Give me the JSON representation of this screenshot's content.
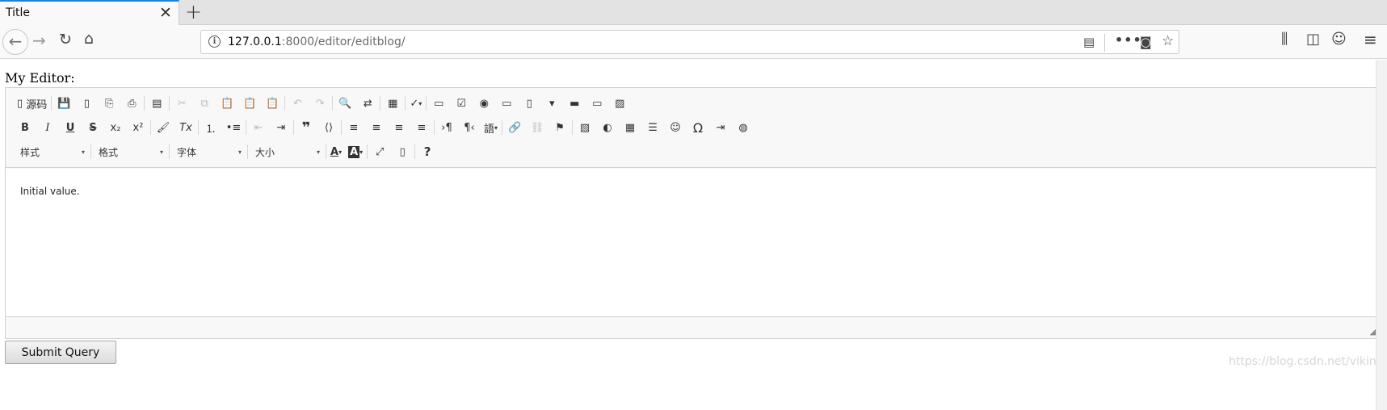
{
  "tab": {
    "title": "Title",
    "close_glyph": "✕",
    "new_tab_glyph": "+"
  },
  "nav": {
    "back_glyph": "←",
    "forward_glyph": "→",
    "reload_glyph": "↻",
    "home_glyph": "⌂",
    "url_host": "127.0.0.1",
    "url_rest": ":8000/editor/editblog/",
    "info_glyph": "i",
    "reader_glyph": "▤",
    "more_glyph": "•••",
    "pocket_glyph": "◙",
    "star_glyph": "☆",
    "library_glyph": "⫼",
    "sidebar_glyph": "◫",
    "account_glyph": "☺",
    "menu_glyph": "≡"
  },
  "page": {
    "label": "My Editor:",
    "submit_label": "Submit Query",
    "watermark": "https://blog.csdn.net/viking"
  },
  "editor": {
    "source_label": "源码",
    "combos": {
      "styles": "样式",
      "format": "格式",
      "font": "字体",
      "size": "大小"
    },
    "content": "Initial value.",
    "resize_glyph": "◢"
  },
  "toolbar_glyphs": {
    "source": "▯",
    "save": "💾",
    "newpage": "▯",
    "preview": "⎘",
    "print": "⎙",
    "templates": "▤",
    "cut": "✂",
    "copy": "⧉",
    "paste": "📋",
    "pastetext": "📋",
    "pasteword": "📋",
    "undo": "↶",
    "redo": "↷",
    "find": "🔍",
    "replace": "⇄",
    "selectall": "▦",
    "spellcheck": "✓",
    "form": "▭",
    "checkbox": "☑",
    "radio": "◉",
    "textfield": "▭",
    "textarea": "▯",
    "select": "▾",
    "button": "▬",
    "imagebutton": "▭",
    "hiddenfield": "▨",
    "bold": "B",
    "italic": "I",
    "underline": "U",
    "strike": "S",
    "subscript": "x₂",
    "superscript": "x²",
    "copyformat": "🖌",
    "removeformat": "Tx",
    "numberedlist": "⒈",
    "bulletedlist": "•≡",
    "outdent": "⇤",
    "indent": "⇥",
    "blockquote": "❞",
    "creatediv": "⟨⟩",
    "alignleft": "≡",
    "aligncenter": "≡",
    "alignright": "≡",
    "justify": "≡",
    "ltr": "›¶",
    "rtl": "¶‹",
    "language": "語",
    "link": "🔗",
    "unlink": "⛓",
    "anchor": "⚑",
    "image": "▧",
    "flash": "◐",
    "table": "▦",
    "hr": "☰",
    "smiley": "☺",
    "specialchar": "Ω",
    "pagebreak": "⇥",
    "iframe": "◍",
    "textcolor": "A",
    "bgcolor": "A",
    "maximize": "⤢",
    "showblocks": "▯",
    "about": "?",
    "dropdown": "▾"
  }
}
